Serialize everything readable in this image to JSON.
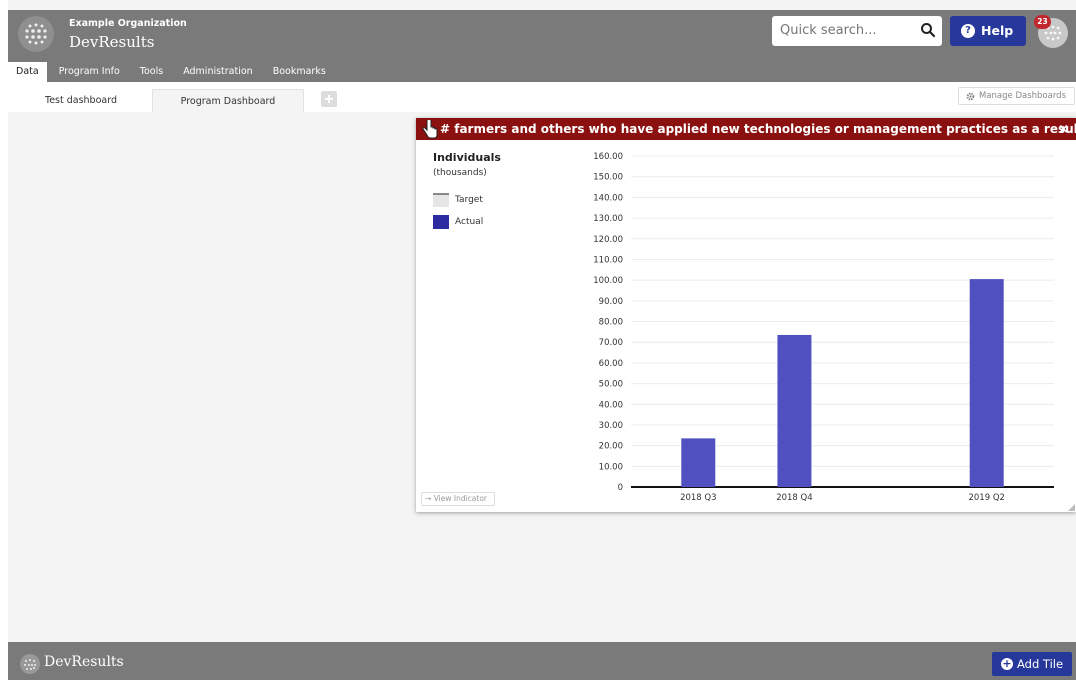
{
  "header": {
    "org_name": "Example Organization",
    "app_name": "DevResults",
    "search_placeholder": "Quick search...",
    "help_label": "Help",
    "notification_count": "23"
  },
  "nav": {
    "items": [
      {
        "label": "Data",
        "active": true
      },
      {
        "label": "Program Info",
        "active": false
      },
      {
        "label": "Tools",
        "active": false
      },
      {
        "label": "Administration",
        "active": false
      },
      {
        "label": "Bookmarks",
        "active": false
      }
    ]
  },
  "dashboard_tabs": [
    {
      "label": "Test dashboard"
    },
    {
      "label": "Program Dashboard"
    }
  ],
  "manage_dashboards_label": "Manage Dashboards",
  "tile": {
    "title": "# farmers and others who have applied new technologies or management practices as a result of USG ...",
    "close": "×",
    "unit": "Individuals",
    "unit_sub": "(thousands)",
    "legend": [
      {
        "label": "Target",
        "color": "#d8d8d8"
      },
      {
        "label": "Actual",
        "color": "#2c2ba0"
      }
    ],
    "view_indicator_label": "View Indicator"
  },
  "chart_data": {
    "type": "bar",
    "categories": [
      "2018 Q3",
      "2018 Q4",
      "2019 Q2"
    ],
    "series": [
      {
        "name": "Actual",
        "values": [
          23.5,
          73.5,
          100.5
        ],
        "color": "#5050c0"
      }
    ],
    "yticks": [
      "0",
      "10.00",
      "20.00",
      "30.00",
      "40.00",
      "50.00",
      "60.00",
      "70.00",
      "80.00",
      "90.00",
      "100.00",
      "110.00",
      "120.00",
      "130.00",
      "140.00",
      "150.00",
      "160.00"
    ],
    "ylim": [
      0,
      160
    ],
    "grid": true,
    "legend": "left"
  },
  "footer": {
    "brand": "DevResults",
    "add_tile_label": "Add Tile"
  }
}
